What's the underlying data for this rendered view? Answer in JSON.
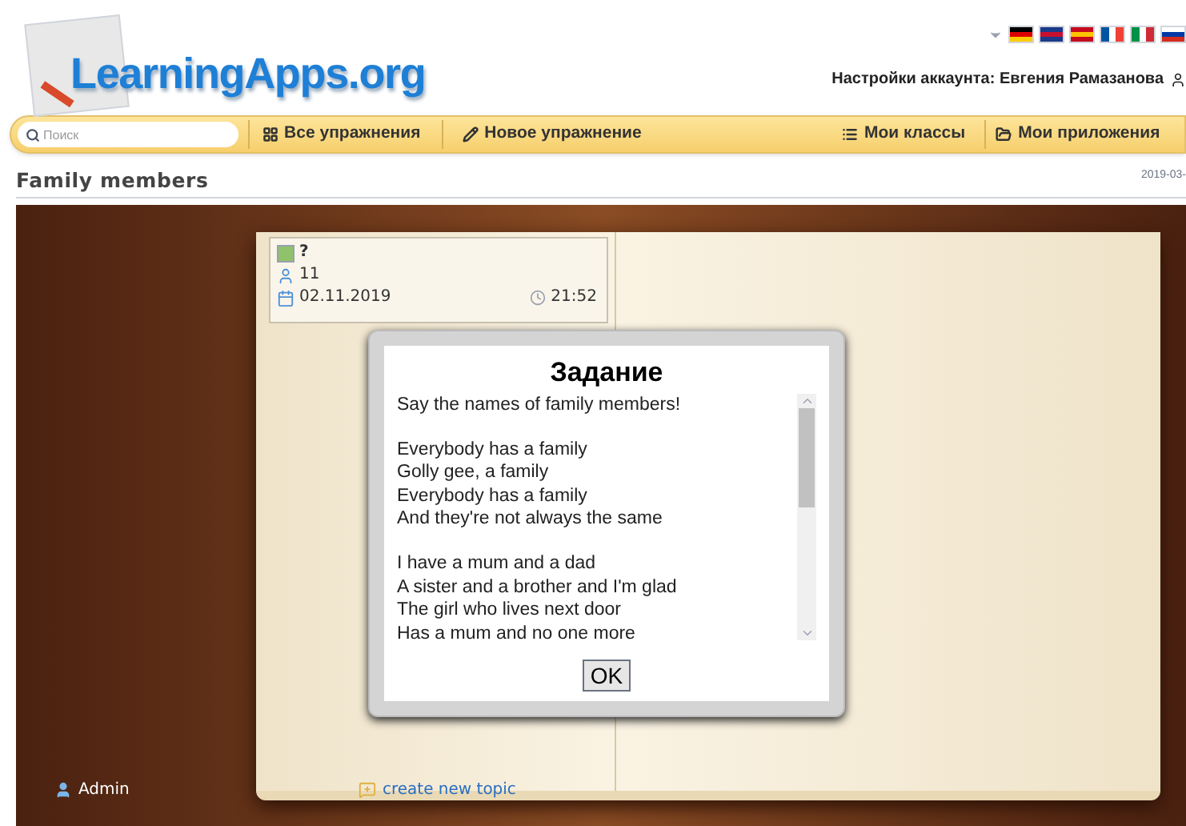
{
  "header": {
    "logo": "LearningApps.org",
    "account": "Настройки аккаунта: Евгения Рамазанова"
  },
  "nav": {
    "search": {
      "placeholder": "Поиск"
    },
    "items": [
      {
        "label": "Все упражнения"
      },
      {
        "label": "Новое упражнение"
      },
      {
        "label": "Мои классы"
      },
      {
        "label": "Мои приложения"
      }
    ]
  },
  "page": {
    "title": "Family members",
    "date": "2019-03-"
  },
  "app": {
    "info": {
      "status": "?",
      "count": "11",
      "date": "02.11.2019",
      "time": "21:52"
    },
    "dialog": {
      "title": "Задание",
      "paragraphs": [
        [
          "Say the names of family members!"
        ],
        [
          "Everybody has a family",
          "Golly gee, a family",
          "Everybody has a family",
          "And they're not always the same"
        ],
        [
          "I have a mum and a dad",
          "A sister and a brother and I'm glad",
          "The girl who lives next door",
          "Has a mum and no one more"
        ]
      ],
      "button": "OK"
    },
    "footer": {
      "user": "Admin",
      "link": "create new topic"
    }
  }
}
